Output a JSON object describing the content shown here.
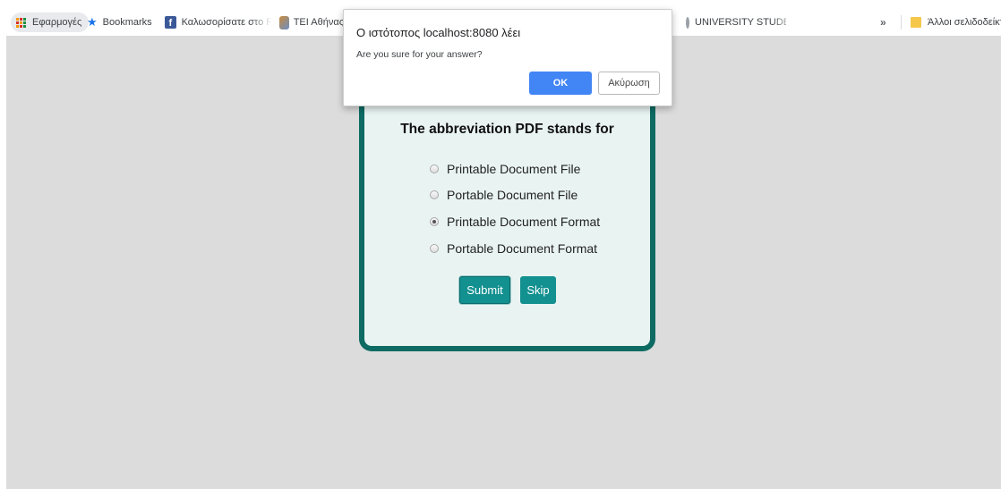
{
  "bookmarks": {
    "apps_label": "Εφαρμογές",
    "bookmarks_label": "Bookmarks",
    "facebook_label": "Καλωσορίσατε στο F",
    "tei_label": "ΤΕΙ Αθήνας",
    "university_label": "UNIVERSITY STUDEN",
    "overflow_label": "»",
    "other_bookmarks_label": "Άλλοι σελιδοδείκτες"
  },
  "dialog": {
    "title": "Ο ιστότοπος localhost:8080 λέει",
    "message": "Are you sure for your answer?",
    "ok_label": "OK",
    "cancel_label": "Ακύρωση"
  },
  "quiz": {
    "question": "The abbreviation PDF stands for",
    "options": [
      {
        "label": "Printable Document File",
        "checked": false
      },
      {
        "label": "Portable Document File",
        "checked": false
      },
      {
        "label": "Printable Document Format",
        "checked": true
      },
      {
        "label": "Portable Document Format",
        "checked": false
      }
    ],
    "submit_label": "Submit",
    "skip_label": "Skip"
  },
  "colors": {
    "page_background": "#dcdcdc",
    "card_border": "#0d6b63",
    "card_background": "#e9f4f2",
    "button_teal": "#139090",
    "dialog_ok": "#4285f4"
  }
}
